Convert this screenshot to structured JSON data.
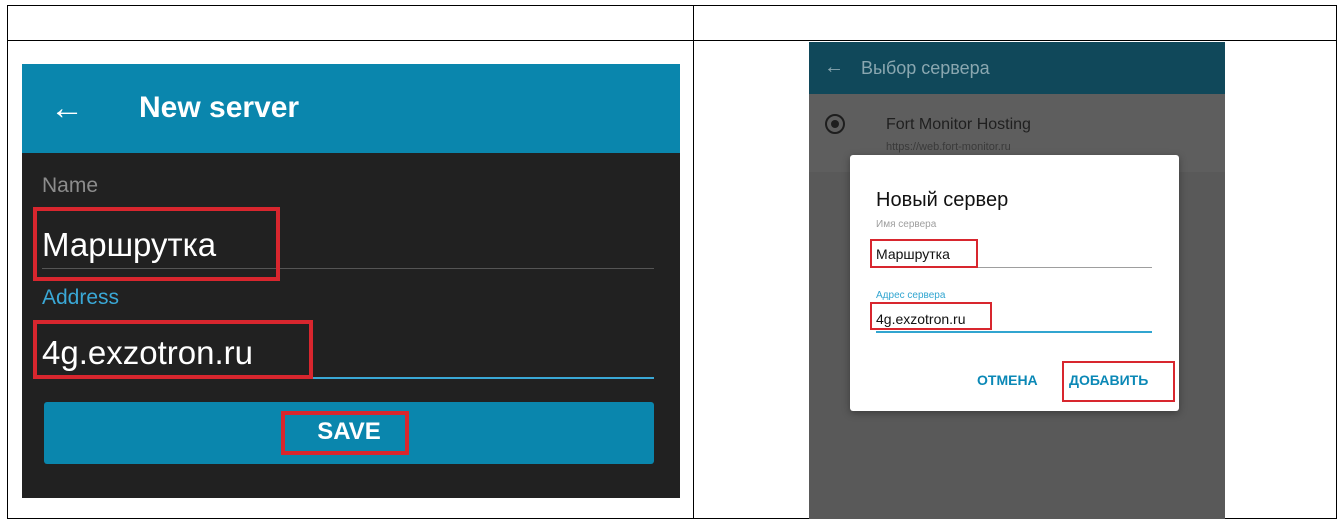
{
  "left": {
    "back_glyph": "←",
    "title": "New server",
    "name_label": "Name",
    "name_value": "Маршрутка",
    "address_label": "Address",
    "address_value": "4g.exzotron.ru",
    "save_label": "SAVE"
  },
  "right": {
    "back_glyph": "←",
    "title": "Выбор сервера",
    "host_name": "Fort Monitor Hosting",
    "host_url": "https://web.fort-monitor.ru",
    "dialog": {
      "title": "Новый сервер",
      "name_label": "Имя сервера",
      "name_value": "Маршрутка",
      "address_label": "Адрес сервера",
      "address_value": "4g.exzotron.ru",
      "cancel_label": "ОТМЕНА",
      "add_label": "ДОБАВИТЬ"
    }
  },
  "colors": {
    "accent_blue": "#0a86ad",
    "highlight_red": "#d8262e",
    "dark_background": "#212121"
  }
}
